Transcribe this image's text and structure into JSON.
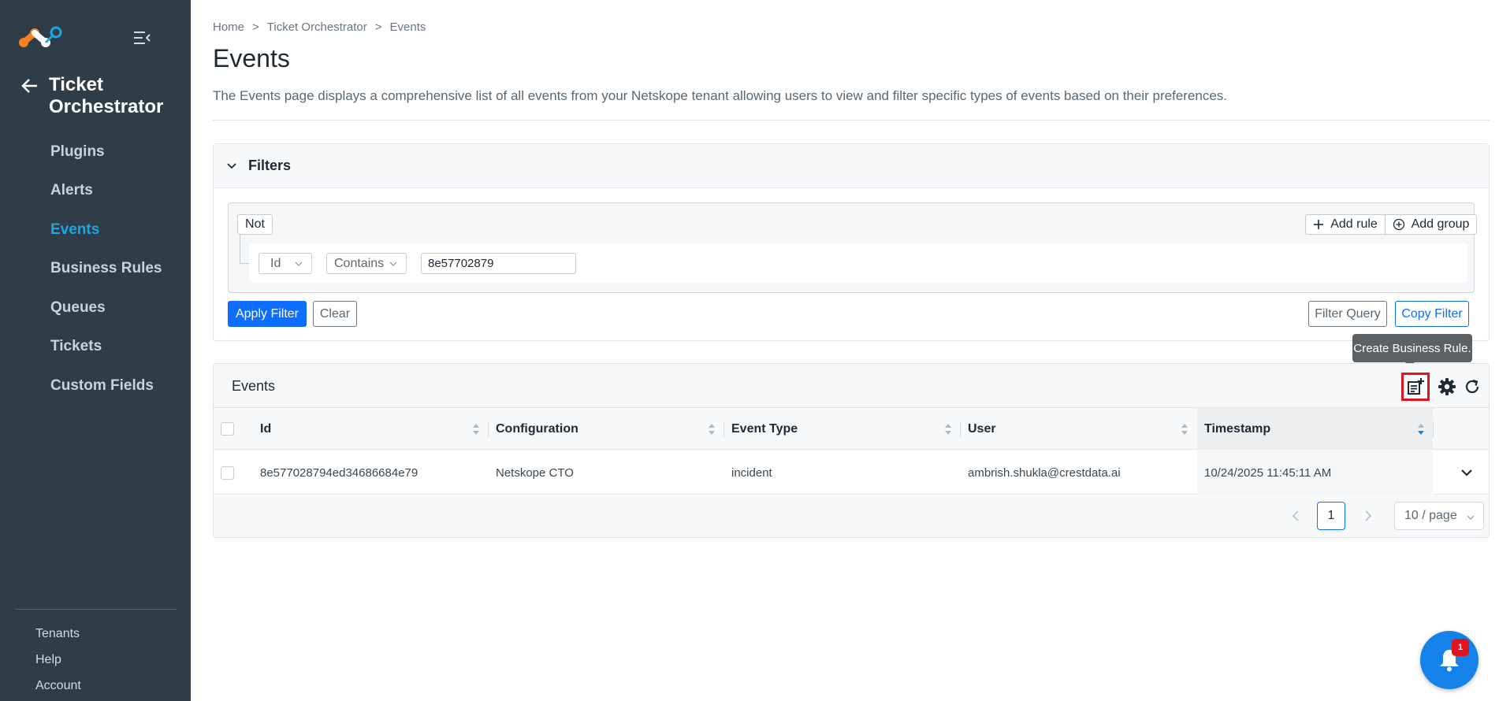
{
  "sidebar": {
    "section_title": "Ticket Orchestrator",
    "items": [
      {
        "label": "Plugins"
      },
      {
        "label": "Alerts"
      },
      {
        "label": "Events",
        "active": true
      },
      {
        "label": "Business Rules"
      },
      {
        "label": "Queues"
      },
      {
        "label": "Tickets"
      },
      {
        "label": "Custom Fields"
      }
    ],
    "bottom_items": [
      {
        "label": "Tenants"
      },
      {
        "label": "Help"
      },
      {
        "label": "Account"
      }
    ],
    "logo_icon": "netskope-logo-icon",
    "collapse_icon": "menu-collapse-icon",
    "back_icon": "arrow-left-icon"
  },
  "breadcrumb": [
    "Home",
    ">",
    "Ticket Orchestrator",
    ">",
    "Events"
  ],
  "page": {
    "title": "Events",
    "description": "The Events page displays a comprehensive list of all events from your Netskope tenant allowing users to view and filter specific types of events based on their preferences."
  },
  "filters": {
    "header_label": "Filters",
    "not_label": "Not",
    "add_rule_label": "Add rule",
    "add_group_label": "Add group",
    "rule": {
      "field": "Id",
      "operator": "Contains",
      "value": "8e57702879"
    },
    "apply_label": "Apply Filter",
    "clear_label": "Clear",
    "filter_query_label": "Filter Query",
    "copy_filter_label": "Copy Filter"
  },
  "events_table": {
    "title": "Events",
    "tooltip": "Create Business Rule.",
    "columns": [
      "Id",
      "Configuration",
      "Event Type",
      "User",
      "Timestamp"
    ],
    "sorted_column": "Timestamp",
    "rows": [
      {
        "id": "8e577028794ed34686684e79",
        "configuration": "Netskope CTO",
        "event_type": "incident",
        "user": "ambrish.shukla@crestdata.ai",
        "timestamp": "10/24/2025 11:45:11 AM"
      }
    ],
    "pagination": {
      "current_page": "1",
      "page_size": "10 / page"
    }
  },
  "notifications": {
    "count": "1"
  },
  "colors": {
    "sidebar_bg": "#2f3d48",
    "active_nav": "#1ba8e0",
    "primary": "#0d6efd",
    "highlight_border": "#e0141e",
    "notification_bg": "#1482e8"
  }
}
